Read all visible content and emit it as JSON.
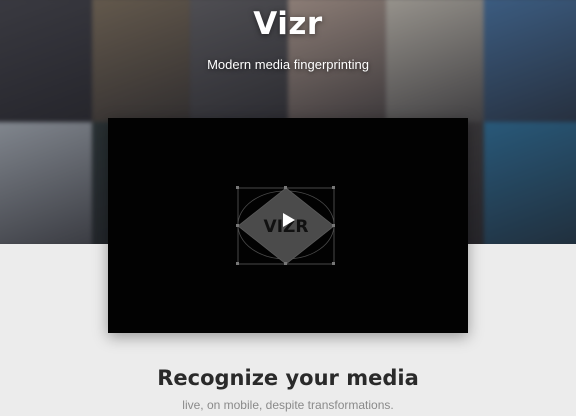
{
  "hero": {
    "logo_text": "Vizr",
    "tagline": "Modern media fingerprinting",
    "posters": [
      {
        "name": "poster-1",
        "color": "#4a4a52"
      },
      {
        "name": "poster-2",
        "color": "#8a7a64"
      },
      {
        "name": "poster-3",
        "color": "#6b6a6e"
      },
      {
        "name": "poster-4",
        "color": "#c9b2a4"
      },
      {
        "name": "poster-5",
        "color": "#d9d3c6"
      },
      {
        "name": "poster-6",
        "color": "#4d7fb4"
      },
      {
        "name": "poster-7",
        "color": "#b8c0c9"
      },
      {
        "name": "poster-8",
        "color": "#2f3b3c"
      },
      {
        "name": "poster-9",
        "color": "#2b6c8c"
      },
      {
        "name": "poster-10",
        "color": "#d0c7bc"
      },
      {
        "name": "poster-11",
        "color": "#4c4848"
      },
      {
        "name": "poster-12",
        "color": "#2f79a8"
      }
    ]
  },
  "video": {
    "watermark_text": "VIZR",
    "play_icon": "play-icon",
    "background": "#020202"
  },
  "content": {
    "headline": "Recognize your media",
    "subline": "live, on mobile, despite transformations."
  }
}
